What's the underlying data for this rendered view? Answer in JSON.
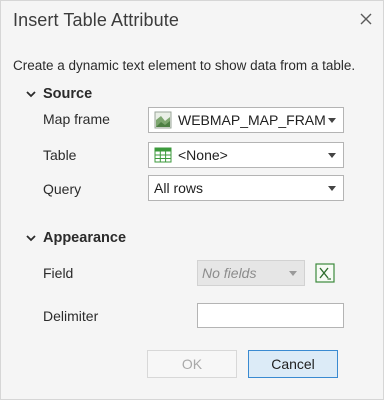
{
  "dialog": {
    "title": "Insert Table Attribute",
    "description": "Create a dynamic text element to show data from a table."
  },
  "source": {
    "heading": "Source",
    "map_frame": {
      "label": "Map frame",
      "value": "WEBMAP_MAP_FRAME"
    },
    "table": {
      "label": "Table",
      "value": "<None>"
    },
    "query": {
      "label": "Query",
      "value": "All rows"
    }
  },
  "appearance": {
    "heading": "Appearance",
    "field": {
      "label": "Field",
      "value": "No fields"
    },
    "delimiter": {
      "label": "Delimiter",
      "value": ""
    }
  },
  "buttons": {
    "ok": "OK",
    "cancel": "Cancel"
  },
  "colors": {
    "accent": "#3a8ad1",
    "cancel_bg": "#dcebf7",
    "disabled_text": "#a9a9a9"
  },
  "icons": {
    "close": "close-icon",
    "section_toggle": "chevron-down-icon",
    "map_frame": "map-frame-icon",
    "table": "table-icon",
    "dropdown": "dropdown-arrow-icon",
    "expression": "expression-icon"
  }
}
